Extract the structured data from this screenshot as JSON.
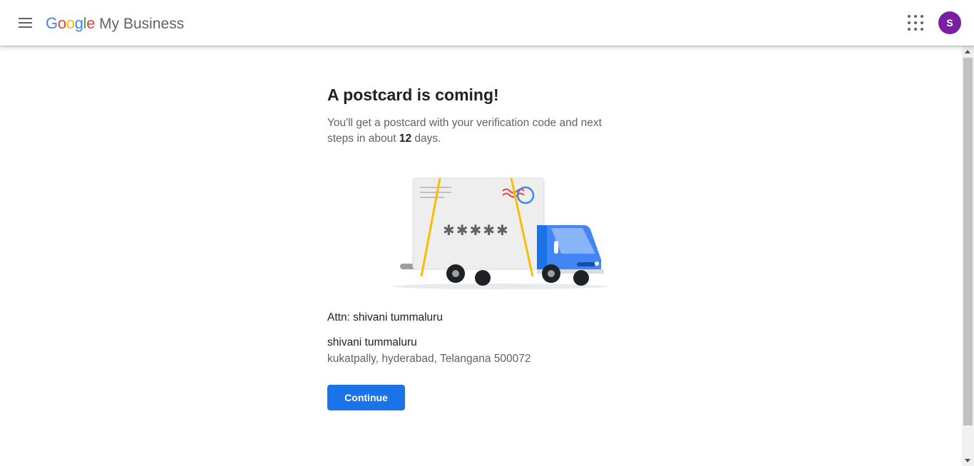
{
  "header": {
    "logo_letters": [
      {
        "ch": "G",
        "color": "#4285F4"
      },
      {
        "ch": "o",
        "color": "#EA4335"
      },
      {
        "ch": "o",
        "color": "#FBBC05"
      },
      {
        "ch": "g",
        "color": "#4285F4"
      },
      {
        "ch": "l",
        "color": "#34A853"
      },
      {
        "ch": "e",
        "color": "#EA4335"
      }
    ],
    "product_name": "My Business",
    "menu_icon": "hamburger-menu-icon",
    "apps_icon": "apps-grid-icon",
    "avatar_letter": "S",
    "avatar_color": "#7B1FA2"
  },
  "main": {
    "title": "A postcard is coming!",
    "desc_prefix": "You'll get a postcard with your verification code and next steps in about ",
    "days": "12",
    "desc_suffix": " days.",
    "illustration": {
      "code_mask": "✱✱✱✱✱",
      "icon": "delivery-truck-postcard-icon"
    },
    "attn": "Attn: shivani tummaluru",
    "recipient_name": "shivani tummaluru",
    "address": "kukatpally, hyderabad, Telangana 500072",
    "continue_label": "Continue"
  },
  "colors": {
    "primary_blue": "#1A73E8",
    "truck_blue": "#4285F4",
    "tape_yellow": "#FBBC04",
    "stamp_red": "#EA4335"
  }
}
